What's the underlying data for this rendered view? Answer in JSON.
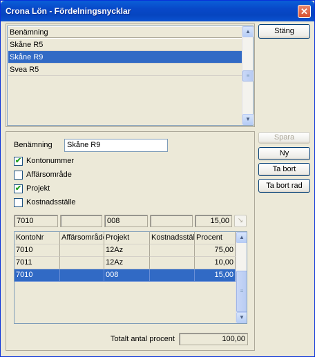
{
  "window": {
    "title": "Crona Lön - Fördelningsnycklar",
    "close_glyph": "✕"
  },
  "buttons": {
    "stang": "Stäng",
    "spara": "Spara",
    "ny": "Ny",
    "ta_bort": "Ta bort",
    "ta_bort_rad": "Ta bort rad"
  },
  "keys_list": {
    "header": "Benämning",
    "rows": [
      "Skåne R5",
      "Skåne R9",
      "Svea R5"
    ],
    "selected_index": 1
  },
  "form": {
    "benamning_label": "Benämning",
    "benamning_value": "Skåne R9",
    "checkboxes": [
      {
        "label": "Kontonummer",
        "checked": true
      },
      {
        "label": "Affärsområde",
        "checked": false
      },
      {
        "label": "Projekt",
        "checked": true
      },
      {
        "label": "Kostnadsställe",
        "checked": false
      }
    ],
    "check_glyph": "✔"
  },
  "entry_row": {
    "konto": "7010",
    "affarsomrade": "",
    "projekt": "008",
    "kostnadsstalle": "",
    "procent": "15,00",
    "apply_icon": "arrow-down-right-icon",
    "apply_glyph": "↘"
  },
  "grid": {
    "columns": [
      "KontoNr",
      "Affärsområde",
      "Projekt",
      "Kostnadsställe",
      "Procent"
    ],
    "rows": [
      [
        "7010",
        "",
        "12Az",
        "",
        "75,00"
      ],
      [
        "7011",
        "",
        "12Az",
        "",
        "10,00"
      ],
      [
        "7010",
        "",
        "008",
        "",
        "15,00"
      ]
    ],
    "selected_index": 2
  },
  "total": {
    "label": "Totalt antal procent",
    "value": "100,00"
  },
  "scroll_glyphs": {
    "up": "▲",
    "down": "▼",
    "grip": "≡"
  }
}
